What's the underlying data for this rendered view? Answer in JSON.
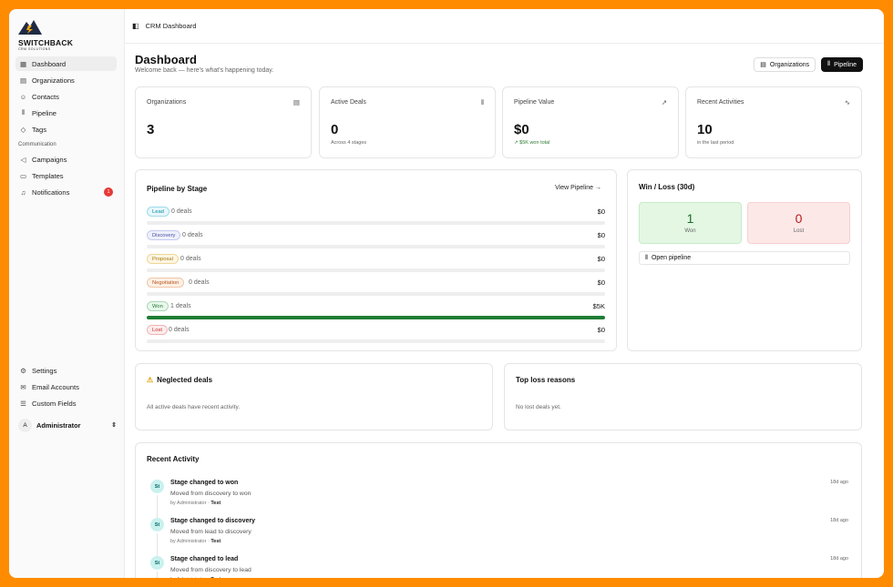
{
  "app": {
    "brand": "SWITCHBACK",
    "brand_sub": "CRM SOLUTIONS"
  },
  "sidebar": {
    "items": [
      {
        "label": "Dashboard",
        "icon": "grid-icon"
      },
      {
        "label": "Organizations",
        "icon": "building-icon"
      },
      {
        "label": "Contacts",
        "icon": "users-icon"
      },
      {
        "label": "Pipeline",
        "icon": "kanban-icon"
      },
      {
        "label": "Tags",
        "icon": "tag-icon"
      }
    ],
    "section_label": "Communication",
    "comm_items": [
      {
        "label": "Campaigns",
        "icon": "megaphone-icon"
      },
      {
        "label": "Templates",
        "icon": "file-icon"
      },
      {
        "label": "Notifications",
        "icon": "bell-icon",
        "badge": "1"
      }
    ],
    "bottom_items": [
      {
        "label": "Settings",
        "icon": "gear-icon"
      },
      {
        "label": "Email Accounts",
        "icon": "mail-icon"
      },
      {
        "label": "Custom Fields",
        "icon": "list-icon"
      }
    ],
    "user": {
      "initial": "A",
      "name": "Administrator"
    }
  },
  "topbar": {
    "breadcrumb": "CRM Dashboard"
  },
  "header": {
    "title": "Dashboard",
    "subtitle": "Welcome back — here's what's happening today.",
    "btn_orgs": "Organizations",
    "btn_pipeline": "Pipeline"
  },
  "stats": [
    {
      "label": "Organizations",
      "value": "3",
      "note": ""
    },
    {
      "label": "Active Deals",
      "value": "0",
      "note": "Across 4 stages"
    },
    {
      "label": "Pipeline Value",
      "value": "$0",
      "note": "↗ $5K won total"
    },
    {
      "label": "Recent Activities",
      "value": "10",
      "note": "in the last period"
    }
  ],
  "pipeline": {
    "title": "Pipeline by Stage",
    "link": "View Pipeline →",
    "stages": [
      {
        "name": "Lead",
        "count": "0 deals",
        "amount": "$0",
        "fill": 0,
        "color": "#0b8aa6",
        "bg": "#e6f7fb",
        "border": "#9fdbe9"
      },
      {
        "name": "Discovery",
        "count": "0 deals",
        "amount": "$0",
        "fill": 0,
        "color": "#4a4fa3",
        "bg": "#eef0fb",
        "border": "#c5c9ee"
      },
      {
        "name": "Proposal",
        "count": "0 deals",
        "amount": "$0",
        "fill": 0,
        "color": "#a5780a",
        "bg": "#fdf6e3",
        "border": "#efd799"
      },
      {
        "name": "Negotiation",
        "count": "0 deals",
        "amount": "$0",
        "fill": 0,
        "color": "#b8561c",
        "bg": "#fdf0e6",
        "border": "#f1c6a6"
      },
      {
        "name": "Won",
        "count": "1 deals",
        "amount": "$5K",
        "fill": 1,
        "color": "#1e7e34",
        "bg": "#e9f7ec",
        "border": "#a8dab4"
      },
      {
        "name": "Lost",
        "count": "0 deals",
        "amount": "$0",
        "fill": 0,
        "color": "#c62828",
        "bg": "#fdecec",
        "border": "#f2b4b4"
      }
    ]
  },
  "winloss": {
    "title": "Win / Loss (30d)",
    "won_value": "1",
    "won_label": "Won",
    "lost_value": "0",
    "lost_label": "Lost",
    "open_label": "Open pipeline"
  },
  "neglected": {
    "title": "Neglected deals",
    "empty": "All active deals have recent activity."
  },
  "loss_reasons": {
    "title": "Top loss reasons",
    "empty": "No lost deals yet."
  },
  "activity": {
    "title": "Recent Activity",
    "items": [
      {
        "initials": "St",
        "title": "Stage changed to won",
        "detail": "Moved from discovery to won",
        "by": "by Administrator ·",
        "target": "Test",
        "ago": "18d ago"
      },
      {
        "initials": "St",
        "title": "Stage changed to discovery",
        "detail": "Moved from lead to discovery",
        "by": "by Administrator ·",
        "target": "Test",
        "ago": "18d ago"
      },
      {
        "initials": "St",
        "title": "Stage changed to lead",
        "detail": "Moved from discovery to lead",
        "by": "by Administrator ·",
        "target": "Test",
        "ago": "18d ago"
      }
    ]
  }
}
